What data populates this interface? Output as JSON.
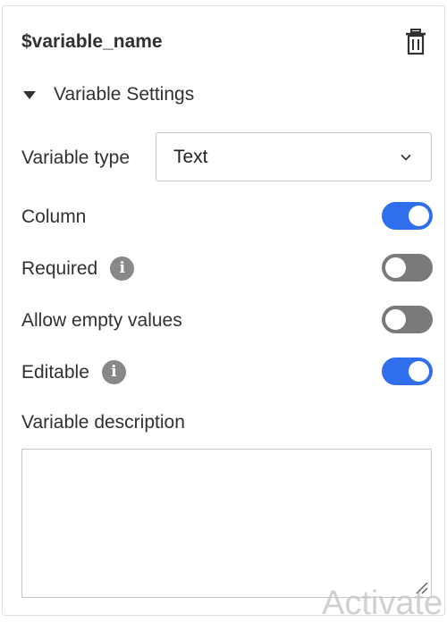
{
  "panel": {
    "title": "$variable_name",
    "section_label": "Variable Settings"
  },
  "variable_type": {
    "label": "Variable type",
    "selected": "Text"
  },
  "toggles": {
    "column": {
      "label": "Column",
      "on": true
    },
    "required": {
      "label": "Required",
      "on": false
    },
    "allow_empty": {
      "label": "Allow empty values",
      "on": false
    },
    "editable": {
      "label": "Editable",
      "on": true
    }
  },
  "description": {
    "label": "Variable description",
    "value": ""
  },
  "watermark": "Activate",
  "colors": {
    "toggle_on": "#2f6fed",
    "toggle_off": "#7a7a7a",
    "info_icon": "#8a8886"
  }
}
